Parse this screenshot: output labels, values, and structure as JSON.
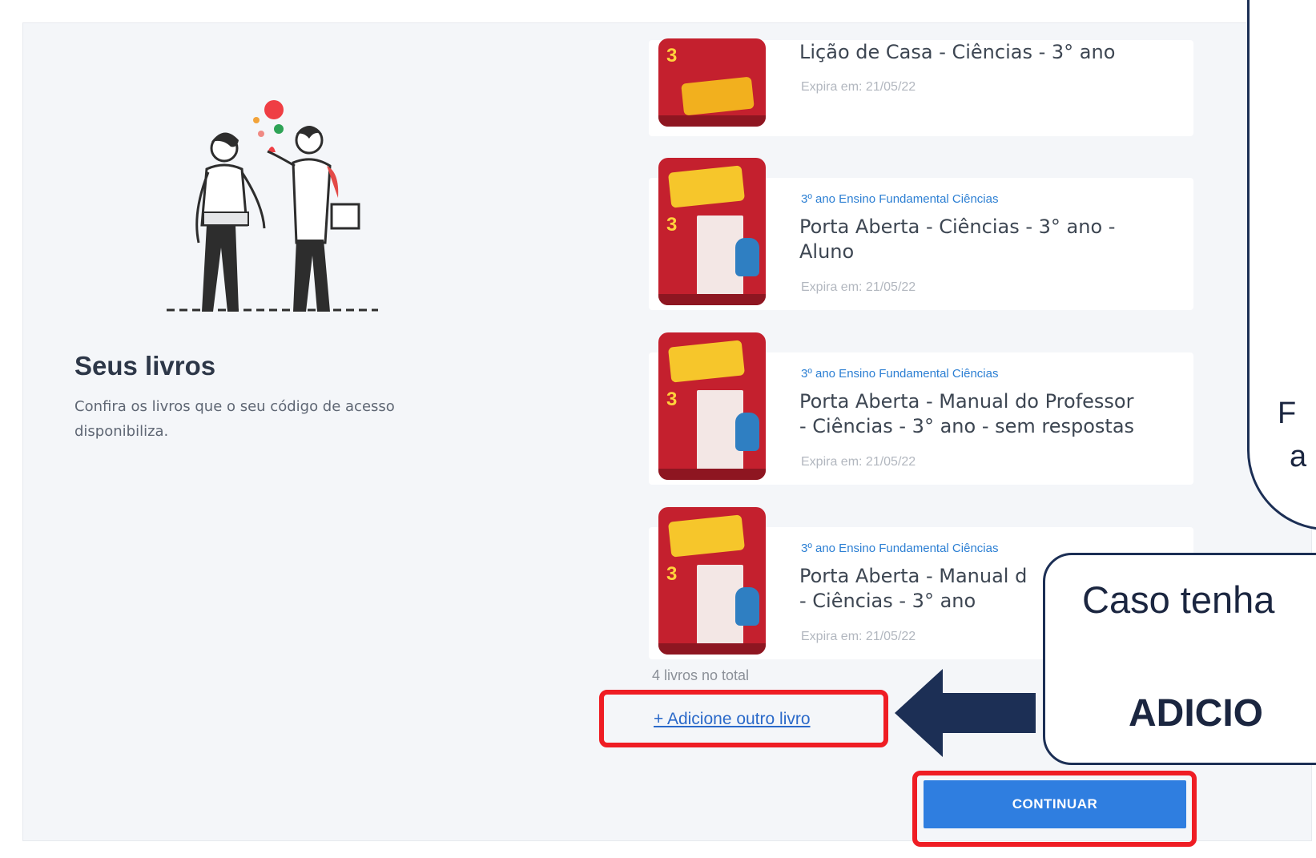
{
  "section": {
    "title": "Seus livros",
    "description": "Confira os livros que o seu código de acesso disponibiliza."
  },
  "books": [
    {
      "category": "",
      "title_lines": [
        "Lição de Casa - Ciências - 3° ano"
      ],
      "expires": "Expira em: 21/05/22",
      "cover_number": "3"
    },
    {
      "category": "3º ano Ensino Fundamental Ciências",
      "title_lines": [
        "Porta Aberta - Ciências - 3° ano -",
        "Aluno"
      ],
      "expires": "Expira em: 21/05/22",
      "cover_number": "3"
    },
    {
      "category": "3º ano Ensino Fundamental Ciências",
      "title_lines": [
        "Porta Aberta - Manual do Professor",
        "- Ciências - 3° ano - sem respostas"
      ],
      "expires": "Expira em: 21/05/22",
      "cover_number": "3"
    },
    {
      "category": "3º ano Ensino Fundamental Ciências",
      "title_lines": [
        "Porta Aberta - Manual d",
        "- Ciências - 3° ano"
      ],
      "expires": "Expira em: 21/05/22",
      "cover_number": "3"
    }
  ],
  "total_label": "4 livros no total",
  "add_book_link": "+ Adicione outro livro",
  "continue_button": "CONTINUAR",
  "callouts": {
    "top_fragments": [
      "F",
      "a"
    ],
    "bottom_line1": "Caso tenha",
    "bottom_line2": "ADICIO"
  },
  "colors": {
    "highlight_red": "#ef1d24",
    "arrow_navy": "#1c2f55",
    "button_blue": "#2f7ee0",
    "link_blue": "#2a69c9",
    "cover_red": "#c4202e"
  },
  "icons": {
    "arrow": "left-arrow-icon",
    "illustration": "two-people-illustration"
  }
}
